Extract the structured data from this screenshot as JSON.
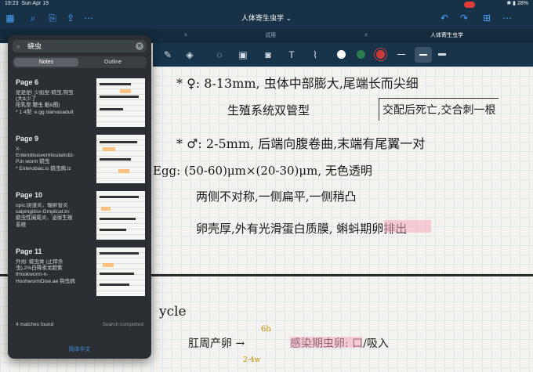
{
  "status": {
    "time": "19:23",
    "date": "Sun Apr 19",
    "battery": "28%"
  },
  "app": {
    "title": "人体寄生虫学 ⌄"
  },
  "tabs": [
    {
      "label": "试用"
    },
    {
      "label": "人体寄生虫学"
    }
  ],
  "search": {
    "query": "蛲虫",
    "tab_notes": "Notes",
    "tab_outline": "Outline"
  },
  "results": [
    {
      "page": "Page 6",
      "snippet": "是是是! 少肌型·蛲虫,钩虫\n(大&少了\n阳乳型:鞭虫 蛔&图)\n* 1 4型: e.gg slarvasadult"
    },
    {
      "page": "Page 9",
      "snippet": "X-\nEnterobiusvermicularisliz-\nP.in worm 蛲虫\n* Enterobiac.is 蛲虫病.lz"
    },
    {
      "page": "Page 10",
      "snippet": "opic:阴道炎、输卵管炎\nsalpingitisx-Gmplicat.tn:\n蛲虫性阑尾炎、泌尿生殖\n系统"
    },
    {
      "page": "Page 11",
      "snippet": "外用: 蛲虫膏 (止痒杀\n虫),2%白降汞龙胆紫\ntHookworm-n-\nHoohwormDise.ae 钩虫病"
    }
  ],
  "footer": {
    "matches": "4 matches found",
    "state": "Search completed",
    "language": "简体中文"
  },
  "notes": {
    "line1": "* ♀: 8-13mm, 虫体中部膨大,尾端长而尖细",
    "line2": "生殖系统双管型",
    "box": "交配后死亡,交合刺一根",
    "line3": "* ♂: 2-5mm, 后端向腹卷曲,末端有尾翼一对",
    "line4": "Egg: (50-60)μm×(20-30)μm, 无色透明",
    "line5": "两侧不对称,一侧扁平,一侧稍凸",
    "line6": "卵壳厚,外有光滑蛋白质膜, 蝌蚪期卵排出",
    "cycle": "ycle",
    "flow1": "肛周产卵 →",
    "flow_time": "6h",
    "flow2": "感染期虫卵: 口/吸入",
    "flow_small": "2-4w"
  }
}
